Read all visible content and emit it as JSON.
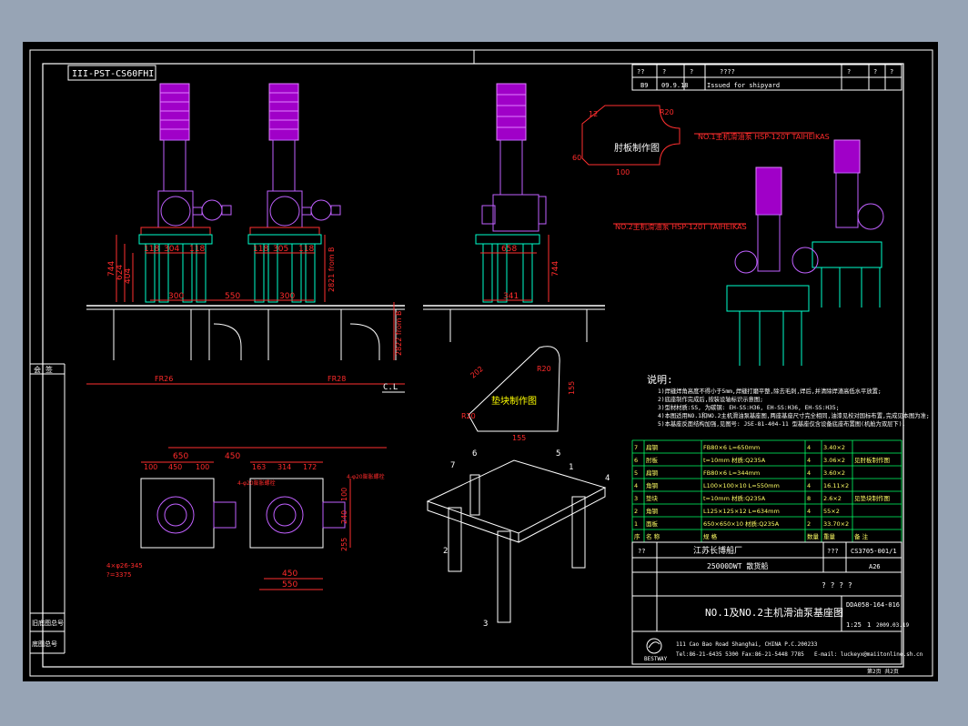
{
  "drawing_id": "III-PST-CS60FHI",
  "rev_header": [
    "??",
    "?",
    "?",
    "????",
    "?",
    "?",
    "?"
  ],
  "rev_row": {
    "rev": "B9",
    "date": "09.9.18",
    "desc": "Issued for shipyard"
  },
  "left_labels": {
    "chk": "会 签",
    "old_no": "旧底图总号",
    "sign": "底图总号"
  },
  "frames": [
    "FR26",
    "FR28"
  ],
  "cl": "C.L",
  "dims_front": {
    "h744": "744",
    "h624": "624",
    "h404": "404",
    "w118a": "118",
    "w304a": "304",
    "w118b": "118",
    "w118c": "118",
    "w305": "305",
    "w118d": "118",
    "w300a": "300",
    "w550": "550",
    "w300b": "300",
    "side": "2821 from B",
    "base": "2822 from B"
  },
  "dims_side": {
    "w658": "658",
    "w341": "341",
    "h744": "744"
  },
  "bracket": {
    "title": "肘板制作图",
    "d12": "12",
    "r20": "R20",
    "h60": "60",
    "w100": "100"
  },
  "pad": {
    "title": "垫块制作图",
    "d202": "202",
    "r20": "R20",
    "d155a": "155",
    "d155b": "155",
    "r20b": "R20"
  },
  "pumps": {
    "no1": "NO.1主机滑油泵 HSP-120T TAIHEIKAS",
    "no2": "NO.2主机滑油泵 HSP-120T TAIHEIKAS"
  },
  "notes": {
    "title": "说明:",
    "lines": [
      "1)焊缝焊角高度不得小于5mm,焊缝打磨平整,除去毛刺,焊后,并清除焊渣高低水平放置;",
      "2)底座制作完成后,按装设轴标识示意图;",
      "3)型材材质:SS, 为碳钢: EH-SS:H36, EH-SS:H36, EH-SS:H35;",
      "4)本图适用NO.1和NO.2主机滑油泵基座图,两座基座尺寸完全相同,油漆见校对国标布置,完成见本图为准;",
      "5)本基座反面结构加强,见图号: JSE-81-404-11 型基座仅含设备底座布置图(机舱为双层下)."
    ]
  },
  "plan_dims": {
    "w650": "650",
    "w450": "450",
    "w100a": "100",
    "w450b": "450",
    "w100b": "100",
    "w163": "163",
    "w314": "314",
    "w172": "172",
    "h240": "240",
    "h100": "100",
    "h255": "255",
    "w450c": "450",
    "w550": "550",
    "leg": "4×φ26-345",
    "note": "?=3375",
    "tag1": "4-φ20膨胀螺栓",
    "tag2": "4-φ20膨胀螺栓"
  },
  "iso_labels": [
    "1",
    "2",
    "3",
    "4",
    "5",
    "6",
    "7"
  ],
  "bom": {
    "rows": [
      [
        "7",
        "扁钢",
        "FB80×6 L=650mm",
        "4",
        "3.40×2",
        ""
      ],
      [
        "6",
        "肘板",
        "t=10mm 材质:Q235A",
        "4",
        "3.06×2",
        "见肘板制作图"
      ],
      [
        "5",
        "扁钢",
        "FB80×6 L=344mm",
        "4",
        "3.60×2",
        ""
      ],
      [
        "4",
        "角钢",
        "L100×100×10 L=550mm",
        "4",
        "16.11×2",
        ""
      ],
      [
        "3",
        "垫块",
        "t=10mm 材质:Q235A",
        "8",
        "2.6×2",
        "见垫块制作图"
      ],
      [
        "2",
        "角钢",
        "L125×125×12 L=634mm",
        "4",
        "55×2",
        ""
      ],
      [
        "1",
        "面板",
        "650×650×10 材质:Q235A",
        "2",
        "33.70×2",
        ""
      ]
    ],
    "head": [
      "序",
      "名 称",
      "规 格",
      "数量",
      "重量",
      "备 注"
    ]
  },
  "title_block": {
    "company": "江苏长博船厂",
    "code_label": "???",
    "code": "CS3705-001/1",
    "ship_label": "??",
    "ship": "25000DWT 散货船",
    "stage": "A26",
    "pq": "? ? ? ?",
    "title": "NO.1及NO.2主机滑油泵基座图",
    "dwg_no": "DDA058-164-016",
    "sheet": "1",
    "scale": "1:25",
    "date": "2009.03.19",
    "addr1": "111 Cao Bao Road Shanghai, CHINA    P.C.200233",
    "addr2": "Tel:86-21-6435 5300  Fax:86-21-5448 7785",
    "email": "E-mail: luckeyx@maiitonline.sh.cn",
    "brand": "BESTWAY",
    "page": "第2页 共2页"
  }
}
